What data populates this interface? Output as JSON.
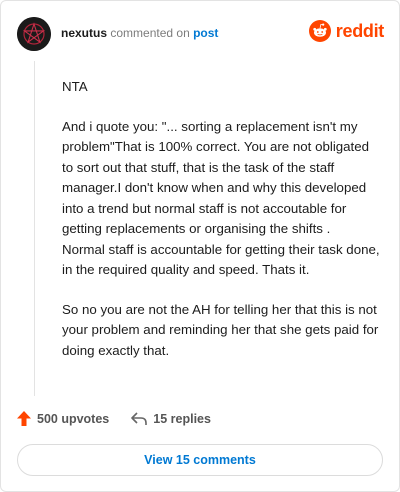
{
  "header": {
    "username": "nexutus",
    "action_text": "commented on",
    "post_link": "post"
  },
  "brand": {
    "name": "reddit",
    "logo_icon": "reddit-snoo-icon",
    "color": "#ff4500"
  },
  "comment": {
    "paragraphs": [
      "NTA",
      "And i quote you: \"... sorting a replacement isn't my problem\"That is 100% correct. You are not obligated to sort out that stuff, that is the task of the staff manager.I don't know when and why this developed into a trend but normal staff is not accoutable for getting replacements or organising the shifts .\nNormal staff is accountable for getting their task done, in the required quality and speed. Thats it.",
      "So no you are not the AH for telling her that this is not your problem and reminding her that she gets paid for doing exactly that."
    ]
  },
  "actions": {
    "upvotes_label": "500 upvotes",
    "upvote_icon": "upvote-arrow-icon",
    "replies_label": "15 replies",
    "reply_icon": "reply-arrow-icon",
    "upvote_color": "#ff4500"
  },
  "view_comments_label": "View 15 comments",
  "link_color": "#0079d3"
}
